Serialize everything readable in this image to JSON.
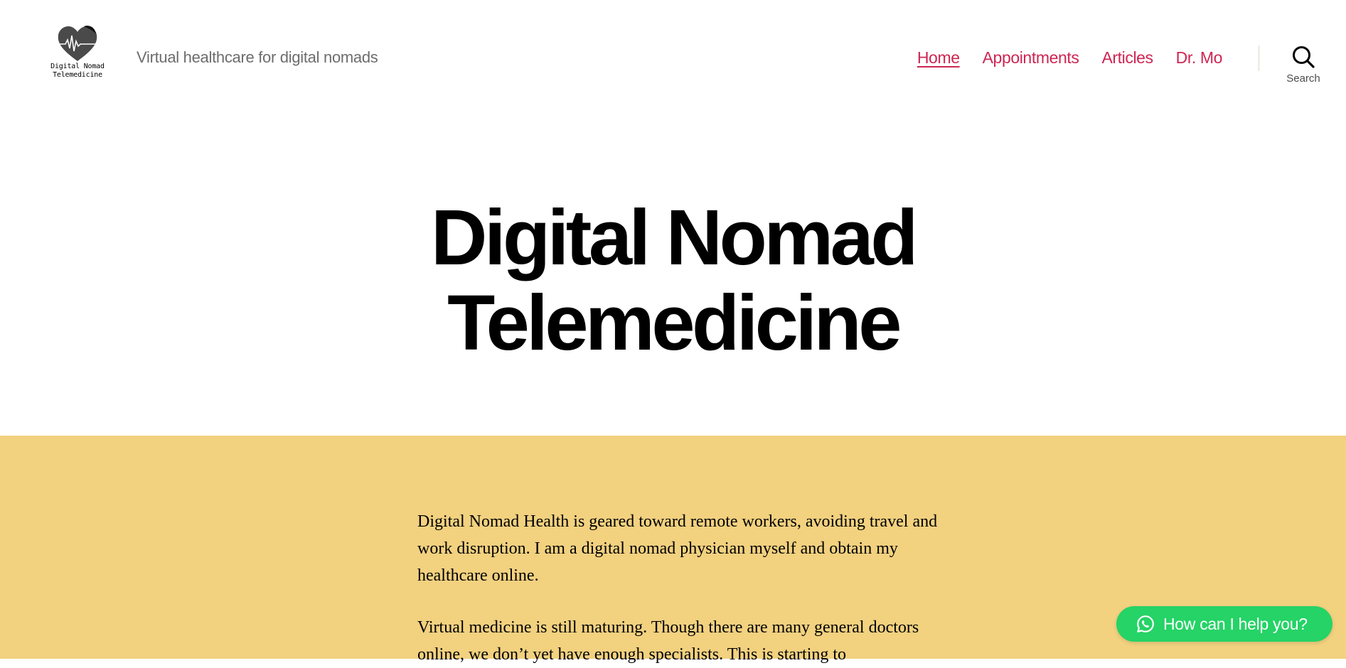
{
  "header": {
    "logo_line1": "Digital Nomad",
    "logo_line2": "Telemedicine",
    "tagline": "Virtual healthcare for digital nomads",
    "nav": [
      {
        "label": "Home",
        "active": true
      },
      {
        "label": "Appointments",
        "active": false
      },
      {
        "label": "Articles",
        "active": false
      },
      {
        "label": "Dr. Mo",
        "active": false
      }
    ],
    "search_label": "Search"
  },
  "hero": {
    "title_line1": "Digital Nomad",
    "title_line2": "Telemedicine"
  },
  "content": {
    "paragraphs": [
      "Digital Nomad Health is geared toward remote workers, avoiding travel and work disruption. I am a digital nomad physician myself and obtain my healthcare online.",
      "Virtual medicine is still maturing. Though there are many general doctors online, we don’t yet have enough specialists. This is starting to"
    ]
  },
  "chat_button": {
    "label": "How can I help you?",
    "icon": "whatsapp-icon"
  },
  "colors": {
    "accent": "#cd2653",
    "content_bg": "#f2d17f",
    "chat_bg": "#25d366",
    "tagline": "#6d6d6d"
  }
}
